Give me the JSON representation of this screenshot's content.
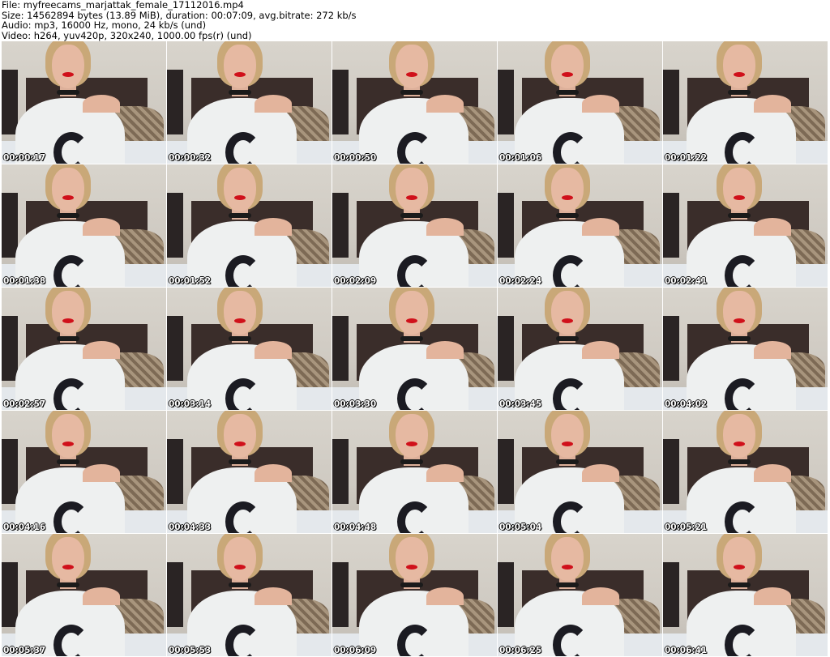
{
  "header": {
    "file": "File: myfreecams_marjattak_female_17112016.mp4",
    "size": "Size: 14562894 bytes (13.89 MiB), duration: 00:07:09, avg.bitrate: 272 kb/s",
    "audio": "Audio: mp3, 16000 Hz, mono, 24 kb/s (und)",
    "video": "Video: h264, yuv420p, 320x240, 1000.00 fps(r) (und)"
  },
  "thumbnails": [
    "00:00:17",
    "00:00:32",
    "00:00:50",
    "00:01:06",
    "00:01:22",
    "00:01:38",
    "00:01:52",
    "00:02:09",
    "00:02:24",
    "00:02:41",
    "00:02:57",
    "00:03:14",
    "00:03:30",
    "00:03:45",
    "00:04:02",
    "00:04:16",
    "00:04:33",
    "00:04:48",
    "00:05:04",
    "00:05:21",
    "00:05:37",
    "00:05:53",
    "00:06:09",
    "00:06:25",
    "00:06:41"
  ]
}
